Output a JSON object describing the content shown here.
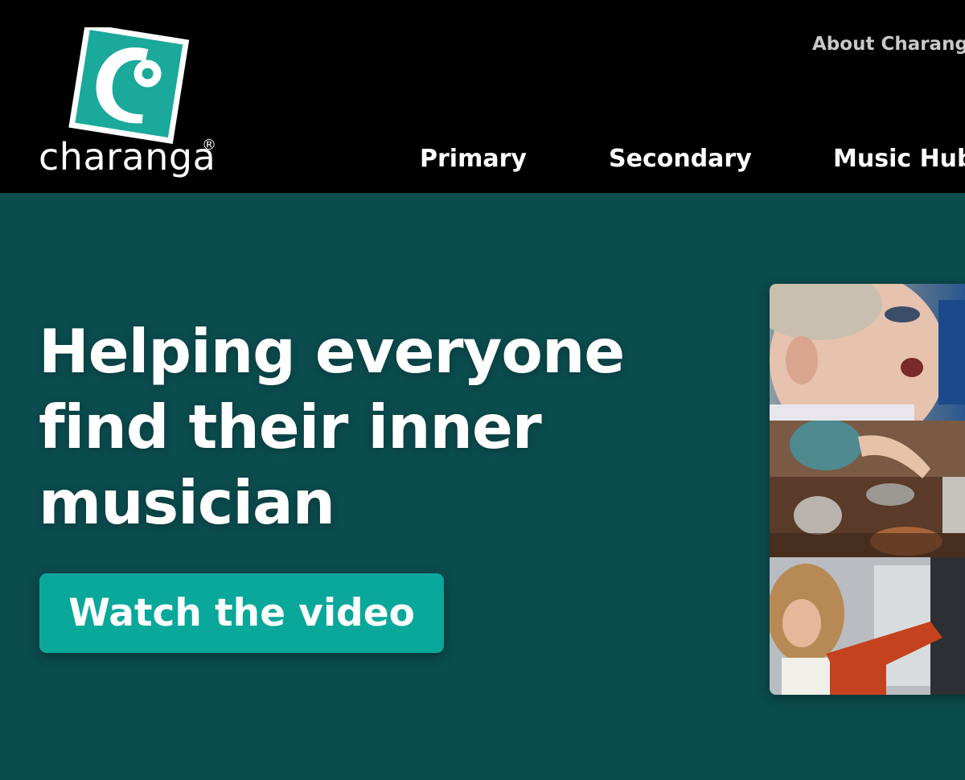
{
  "header": {
    "logo": {
      "wordmark": "charanga",
      "registered": "®",
      "icon": "charanga-c-logo-icon"
    },
    "top_link": "About Charanga",
    "nav": [
      {
        "label": "Primary"
      },
      {
        "label": "Secondary"
      },
      {
        "label": "Music Hubs"
      }
    ]
  },
  "hero": {
    "headline": "Helping everyone find their inner musician",
    "cta_label": "Watch the video",
    "photos": [
      {
        "icon": "photo-boy-singing"
      },
      {
        "icon": "photo-child-playing-pots"
      },
      {
        "icon": "photo-teacher-conducting"
      }
    ]
  },
  "colors": {
    "header_bg": "#000000",
    "hero_bg": "#0b4c4e",
    "brand_teal": "#0aa89a",
    "text": "#ffffff",
    "muted_link": "#c8c8c8"
  }
}
